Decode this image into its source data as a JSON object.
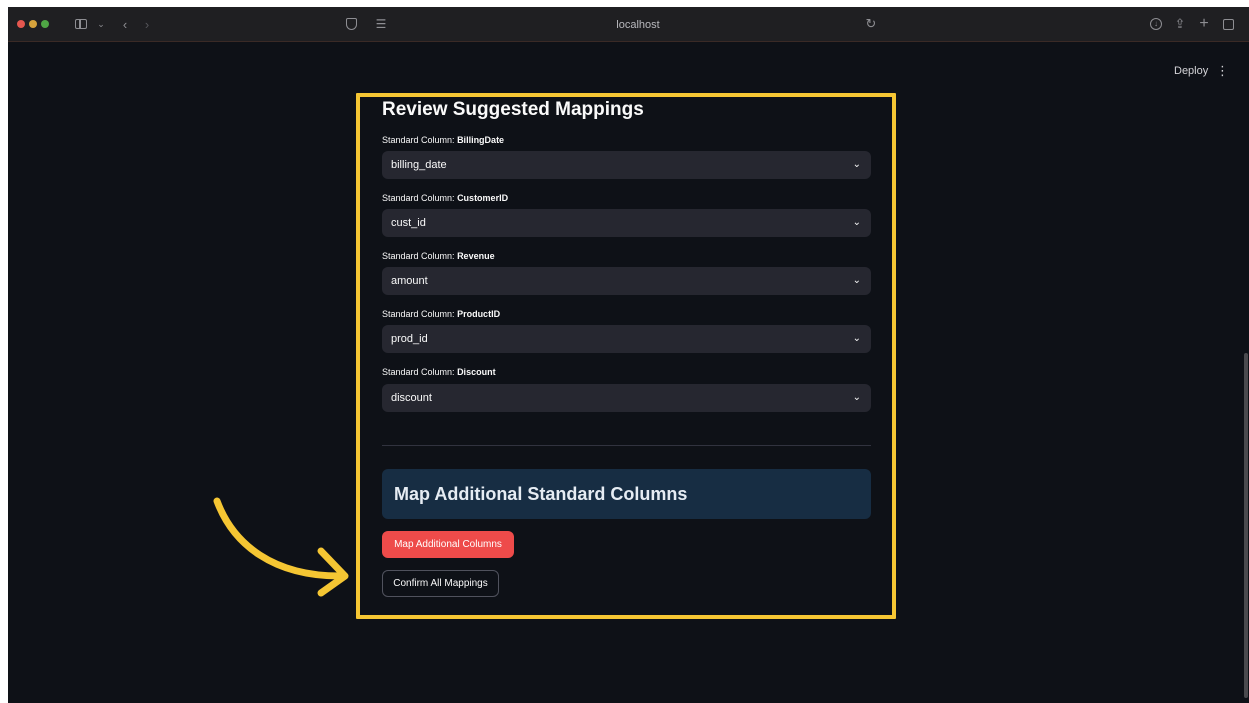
{
  "browser": {
    "url": "localhost"
  },
  "header": {
    "deploy_label": "Deploy",
    "menu_label": "⋮"
  },
  "review": {
    "title": "Review Suggested Mappings",
    "label_prefix": "Standard Column:",
    "fields": [
      {
        "column": "BillingDate",
        "value": "billing_date"
      },
      {
        "column": "CustomerID",
        "value": "cust_id"
      },
      {
        "column": "Revenue",
        "value": "amount"
      },
      {
        "column": "ProductID",
        "value": "prod_id"
      },
      {
        "column": "Discount",
        "value": "discount"
      }
    ]
  },
  "additional": {
    "title": "Map Additional Standard Columns",
    "map_button": "Map Additional Columns",
    "confirm_button": "Confirm All Mappings"
  },
  "colors": {
    "highlight": "#f5c633",
    "primary_button": "#ee4b4a",
    "info_box": "#172d43",
    "app_background": "#0e1117"
  }
}
